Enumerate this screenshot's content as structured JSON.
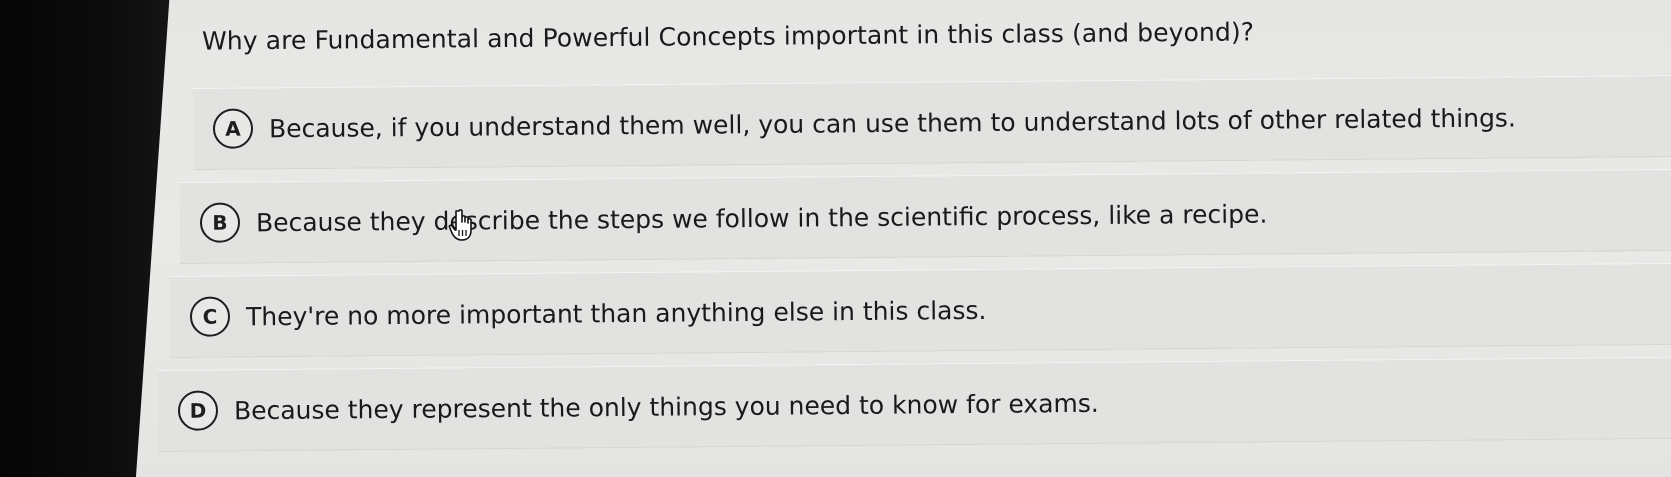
{
  "question": {
    "text": "Why are Fundamental and Powerful Concepts important in this class (and beyond)?"
  },
  "options": [
    {
      "letter": "A",
      "text": "Because, if you understand them well, you can use them to understand lots of other related things."
    },
    {
      "letter": "B",
      "text": "Because they describe the steps we follow in the scientific process, like a recipe."
    },
    {
      "letter": "C",
      "text": "They're no more important than anything else in this class."
    },
    {
      "letter": "D",
      "text": "Because they represent the only things you need to know for exams."
    }
  ],
  "cursor": {
    "icon": "hand-pointer-icon"
  },
  "colors": {
    "background": "#e6e6e4",
    "option_band": "#e2e2e0",
    "text": "#1a1a1a",
    "bezel": "#0c0c0c"
  }
}
